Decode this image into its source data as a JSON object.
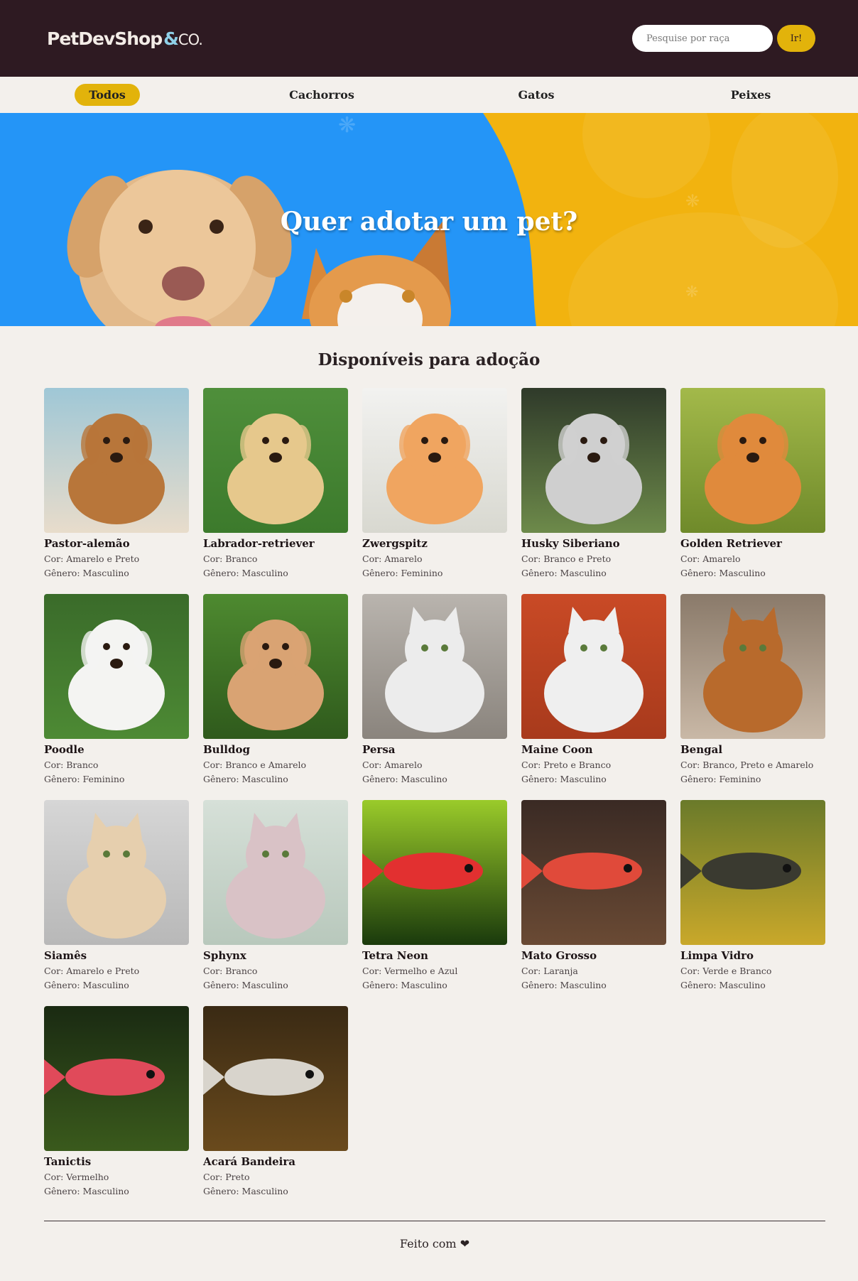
{
  "header": {
    "logo_main": "PetDevShop",
    "logo_amp": "&",
    "logo_co": "CO.",
    "search_placeholder": "Pesquise por raça",
    "search_button": "Ir!"
  },
  "nav": {
    "items": [
      {
        "label": "Todos",
        "active": true
      },
      {
        "label": "Cachorros",
        "active": false
      },
      {
        "label": "Gatos",
        "active": false
      },
      {
        "label": "Peixes",
        "active": false
      }
    ]
  },
  "hero": {
    "title": "Quer adotar um pet?"
  },
  "main": {
    "title": "Disponíveis para adoção",
    "color_prefix": "Cor: ",
    "gender_prefix": "Gênero: ",
    "pets": [
      {
        "name": "Pastor-alemão",
        "color": "Amarelo e Preto",
        "gender": "Masculino",
        "icon": "dog-photo",
        "bg": [
          "#9fc7d6",
          "#e8dccb"
        ],
        "fg": "#b8763a"
      },
      {
        "name": "Labrador-retriever",
        "color": "Branco",
        "gender": "Masculino",
        "icon": "dog-photo",
        "bg": [
          "#4f8f3b",
          "#3c7a2c"
        ],
        "fg": "#e6c88c"
      },
      {
        "name": "Zwergspitz",
        "color": "Amarelo",
        "gender": "Feminino",
        "icon": "dog-photo",
        "bg": [
          "#f2f2f0",
          "#d8d8d0"
        ],
        "fg": "#f0a560"
      },
      {
        "name": "Husky Siberiano",
        "color": "Branco e Preto",
        "gender": "Masculino",
        "icon": "dog-photo",
        "bg": [
          "#2f3a2a",
          "#6d8a4a"
        ],
        "fg": "#cfcfcf"
      },
      {
        "name": "Golden Retriever",
        "color": "Amarelo",
        "gender": "Masculino",
        "icon": "dog-photo",
        "bg": [
          "#a3b94a",
          "#6f8a2a"
        ],
        "fg": "#e08a3c"
      },
      {
        "name": "Poodle",
        "color": "Branco",
        "gender": "Feminino",
        "icon": "dog-photo",
        "bg": [
          "#3a6b2a",
          "#4d8a34"
        ],
        "fg": "#f4f4f2"
      },
      {
        "name": "Bulldog",
        "color": "Branco e Amarelo",
        "gender": "Masculino",
        "icon": "dog-photo",
        "bg": [
          "#4e8a30",
          "#2f5a1c"
        ],
        "fg": "#d9a373"
      },
      {
        "name": "Persa",
        "color": "Amarelo",
        "gender": "Masculino",
        "icon": "cat-photo",
        "bg": [
          "#b9b4ae",
          "#8a847d"
        ],
        "fg": "#ececec"
      },
      {
        "name": "Maine Coon",
        "color": "Preto e Branco",
        "gender": "Masculino",
        "icon": "cat-photo",
        "bg": [
          "#c94a26",
          "#a83a1c"
        ],
        "fg": "#efefef"
      },
      {
        "name": "Bengal",
        "color": "Branco, Preto e Amarelo",
        "gender": "Feminino",
        "icon": "cat-photo",
        "bg": [
          "#8a7a6a",
          "#c9b8a6"
        ],
        "fg": "#b86a2c"
      },
      {
        "name": "Siamês",
        "color": "Amarelo e Preto",
        "gender": "Masculino",
        "icon": "cat-photo",
        "bg": [
          "#d6d6d6",
          "#b8b8b8"
        ],
        "fg": "#e6cfae"
      },
      {
        "name": "Sphynx",
        "color": "Branco",
        "gender": "Masculino",
        "icon": "cat-photo",
        "bg": [
          "#d6e0d8",
          "#b8c8bc"
        ],
        "fg": "#d9c2c6"
      },
      {
        "name": "Tetra Neon",
        "color": "Vermelho e Azul",
        "gender": "Masculino",
        "icon": "fish-photo",
        "bg": [
          "#9acb2a",
          "#1a3a0c"
        ],
        "fg": "#e23030"
      },
      {
        "name": "Mato Grosso",
        "color": "Laranja",
        "gender": "Masculino",
        "icon": "fish-photo",
        "bg": [
          "#3a2a24",
          "#6a4a34"
        ],
        "fg": "#e04a3a"
      },
      {
        "name": "Limpa Vidro",
        "color": "Verde e Branco",
        "gender": "Masculino",
        "icon": "fish-photo",
        "bg": [
          "#6a7a2a",
          "#c9a82a"
        ],
        "fg": "#3a3a30"
      },
      {
        "name": "Tanictis",
        "color": "Vermelho",
        "gender": "Masculino",
        "icon": "fish-photo",
        "bg": [
          "#1a2a12",
          "#3a5a1c"
        ],
        "fg": "#e04a5a"
      },
      {
        "name": "Acará Bandeira",
        "color": "Preto",
        "gender": "Masculino",
        "icon": "fish-photo",
        "bg": [
          "#3a2a14",
          "#6a4a1c"
        ],
        "fg": "#d8d4cc"
      }
    ]
  },
  "footer": {
    "text": "Feito com",
    "heart": "❤"
  },
  "colors": {
    "header_bg": "#2e1a22",
    "accent": "#e2b30b",
    "hero_blue": "#2495f7",
    "hero_yellow": "#f2b30f",
    "page_bg": "#f3f0ec"
  }
}
